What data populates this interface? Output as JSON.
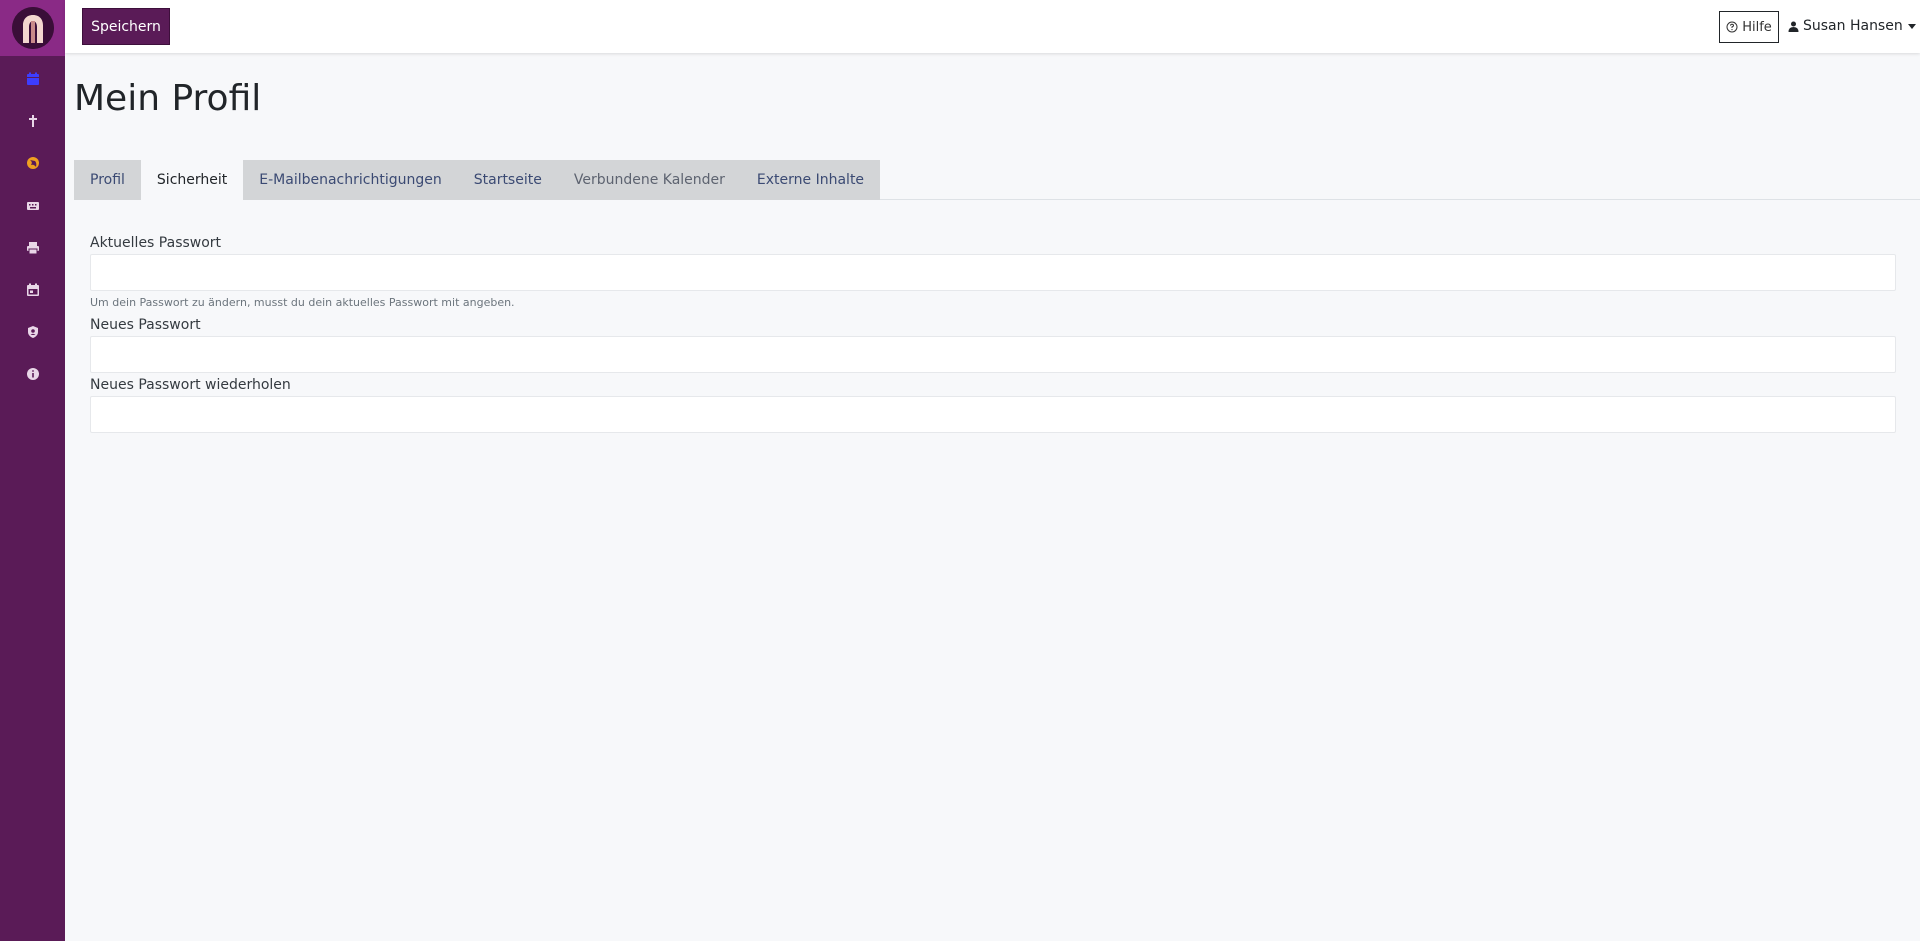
{
  "toolbar": {
    "save_label": "Speichern"
  },
  "header": {
    "help_label": "Hilfe",
    "user_name": "Susan Hansen"
  },
  "sidebar": {
    "items": [
      {
        "icon": "calendar-icon",
        "color": "#3d3dff"
      },
      {
        "icon": "cross-icon",
        "color": "#e9d7e8"
      },
      {
        "icon": "globe-icon",
        "color": "#f0a020"
      },
      {
        "icon": "keyboard-icon",
        "color": "#e9d7e8"
      },
      {
        "icon": "printer-icon",
        "color": "#e9d7e8"
      },
      {
        "icon": "calendar-day-icon",
        "color": "#e9d7e8"
      },
      {
        "icon": "user-shield-icon",
        "color": "#e9d7e8"
      },
      {
        "icon": "info-icon",
        "color": "#e9d7e8"
      }
    ]
  },
  "page": {
    "title": "Mein Profil"
  },
  "tabs": [
    {
      "label": "Profil"
    },
    {
      "label": "Sicherheit",
      "active": true
    },
    {
      "label": "E-Mailbenachrichtigungen"
    },
    {
      "label": "Startseite"
    },
    {
      "label": "Verbundene Kalender"
    },
    {
      "label": "Externe Inhalte"
    }
  ],
  "form": {
    "current_password_label": "Aktuelles Passwort",
    "current_password_help": "Um dein Passwort zu ändern, musst du dein aktuelles Passwort mit angeben.",
    "new_password_label": "Neues Passwort",
    "repeat_password_label": "Neues Passwort wiederholen"
  },
  "colors": {
    "brand": "#5a1b57",
    "brand_light": "#8a2a86",
    "background": "#f7f8fa"
  }
}
